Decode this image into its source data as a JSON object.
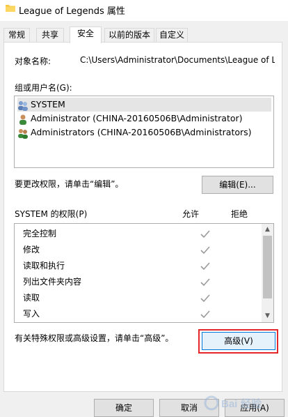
{
  "window": {
    "title": "League of Legends 属性"
  },
  "tabs": [
    {
      "label": "常规"
    },
    {
      "label": "共享"
    },
    {
      "label": "安全"
    },
    {
      "label": "以前的版本"
    },
    {
      "label": "自定义"
    }
  ],
  "object": {
    "label": "对象名称:",
    "value": "C:\\Users\\Administrator\\Documents\\League of Le"
  },
  "groups": {
    "label": "组或用户名(G):",
    "items": [
      {
        "name": "SYSTEM"
      },
      {
        "name": "Administrator (CHINA-20160506B\\Administrator)"
      },
      {
        "name": "Administrators (CHINA-20160506B\\Administrators)"
      }
    ]
  },
  "edit": {
    "hint": "要更改权限，请单击“编辑”。",
    "button": "编辑(E)..."
  },
  "permissions": {
    "label": "SYSTEM 的权限(P)",
    "allow_header": "允许",
    "deny_header": "拒绝",
    "rows": [
      {
        "name": "完全控制",
        "allow": true,
        "deny": false
      },
      {
        "name": "修改",
        "allow": true,
        "deny": false
      },
      {
        "name": "读取和执行",
        "allow": true,
        "deny": false
      },
      {
        "name": "列出文件夹内容",
        "allow": true,
        "deny": false
      },
      {
        "name": "读取",
        "allow": true,
        "deny": false
      },
      {
        "name": "写入",
        "allow": true,
        "deny": false
      }
    ]
  },
  "advanced": {
    "hint": "有关特殊权限或高级设置，请单击“高级”。",
    "button": "高级(V)"
  },
  "footer": {
    "ok": "确定",
    "cancel": "取消",
    "apply": "应用(A)"
  },
  "colors": {
    "highlight": "#e3262a",
    "selected_row": "#e5e5e5",
    "check": "#9a9a9a"
  }
}
